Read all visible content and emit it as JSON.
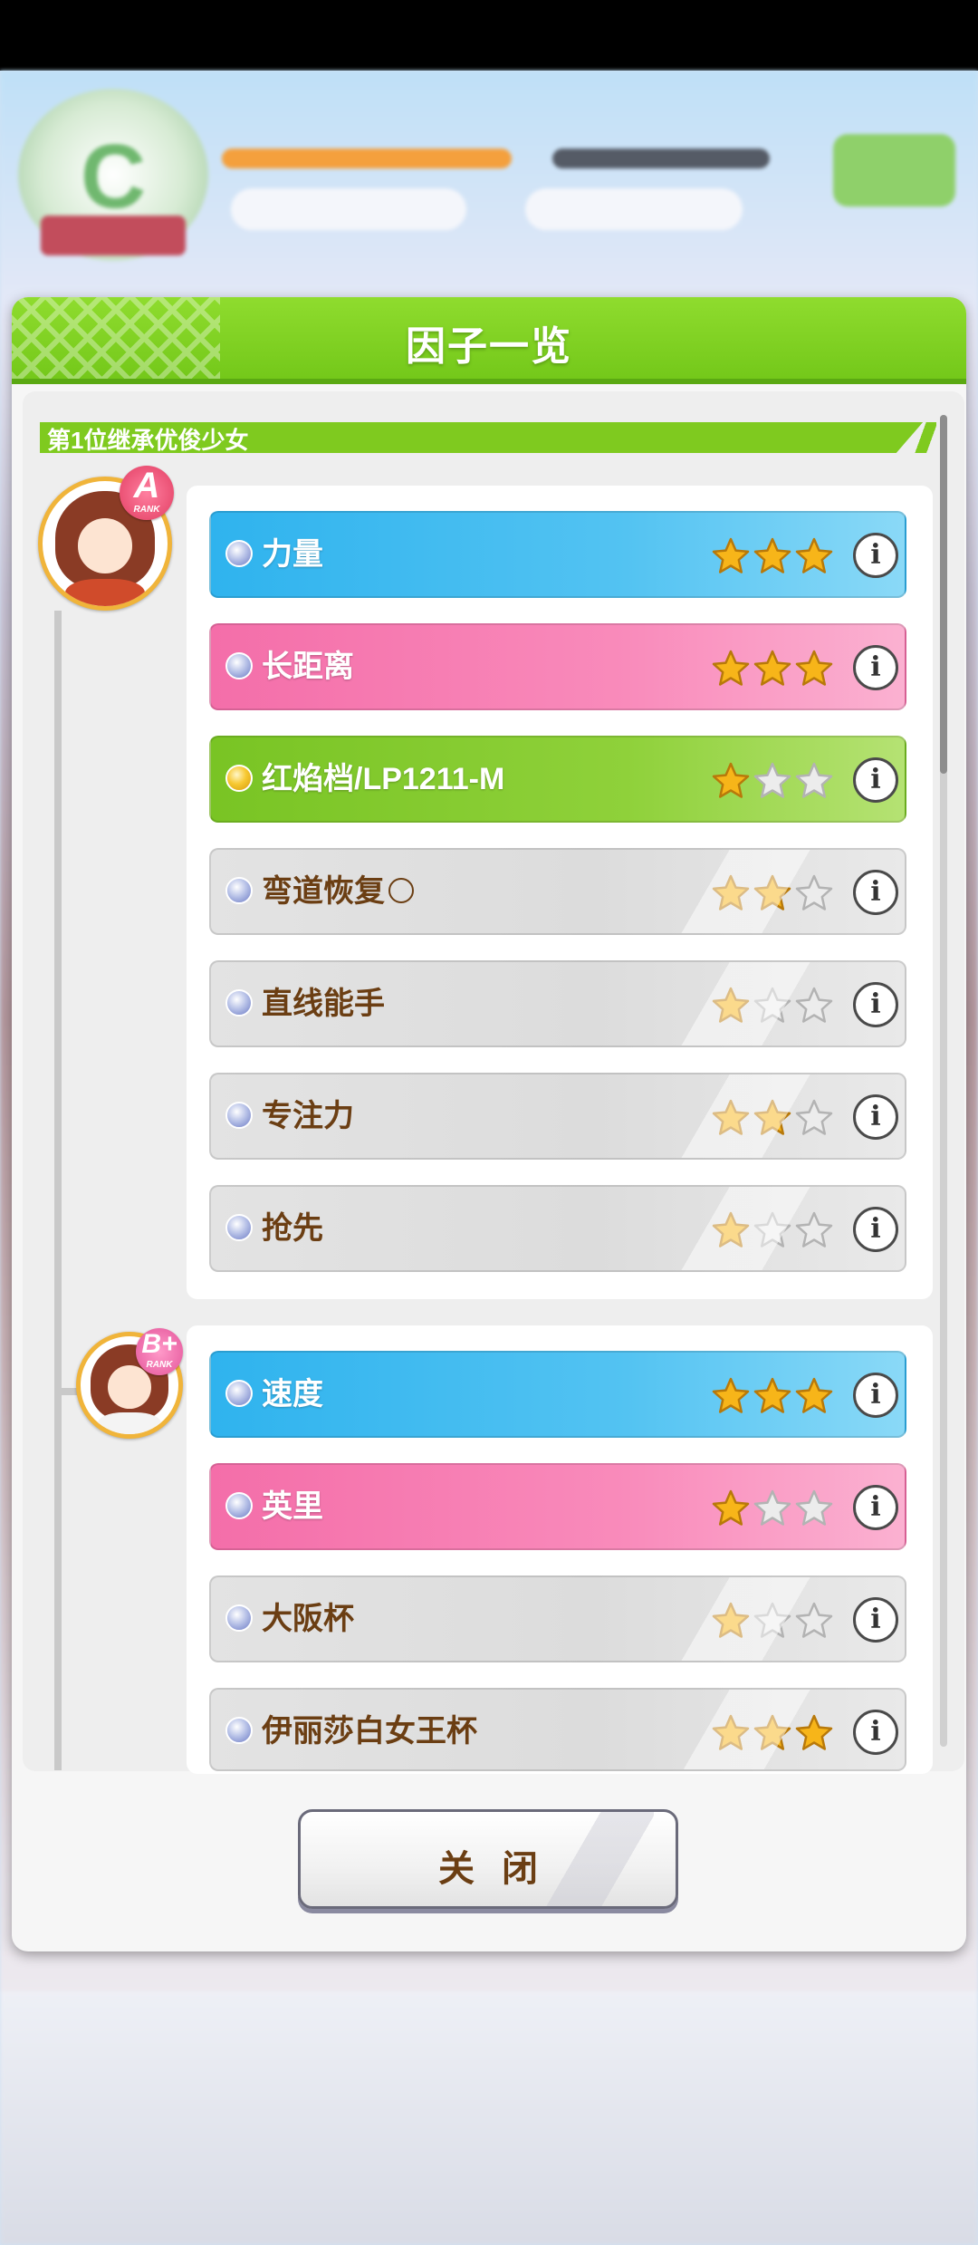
{
  "modal": {
    "title": "因子一览",
    "close_label": "关闭"
  },
  "sections": [
    {
      "title": "第1位继承优俊少女",
      "members": [
        {
          "rank": "A",
          "rank_sub": "RANK",
          "factors": [
            {
              "name": "力量",
              "color": "blue",
              "stars": 3
            },
            {
              "name": "长距离",
              "color": "pink",
              "stars": 3
            },
            {
              "name": "红焰档/LP1211-M",
              "color": "green",
              "stars": 1
            },
            {
              "name": "弯道恢复",
              "color": "gray",
              "stars": 2,
              "suffix": "circle"
            },
            {
              "name": "直线能手",
              "color": "gray",
              "stars": 1
            },
            {
              "name": "专注力",
              "color": "gray",
              "stars": 2
            },
            {
              "name": "抢先",
              "color": "gray",
              "stars": 1
            }
          ]
        },
        {
          "rank": "B+",
          "rank_sub": "RANK",
          "factors": [
            {
              "name": "速度",
              "color": "blue",
              "stars": 3
            },
            {
              "name": "英里",
              "color": "pink",
              "stars": 1
            },
            {
              "name": "大阪杯",
              "color": "gray",
              "stars": 1
            },
            {
              "name": "伊丽莎白女王杯",
              "color": "gray",
              "stars": 3
            }
          ]
        }
      ]
    }
  ],
  "colors": {
    "header_green": "#7fca1f",
    "blue_factor": "#2fb3ee",
    "pink_factor": "#f46ea9",
    "green_factor": "#79c424",
    "gray_factor": "#e0e0e0",
    "label_brown": "#6b3e13",
    "star_gold": "#f7b519"
  },
  "icons": {
    "info": "info-icon",
    "star": "star-icon",
    "bullet": "orb-icon"
  }
}
